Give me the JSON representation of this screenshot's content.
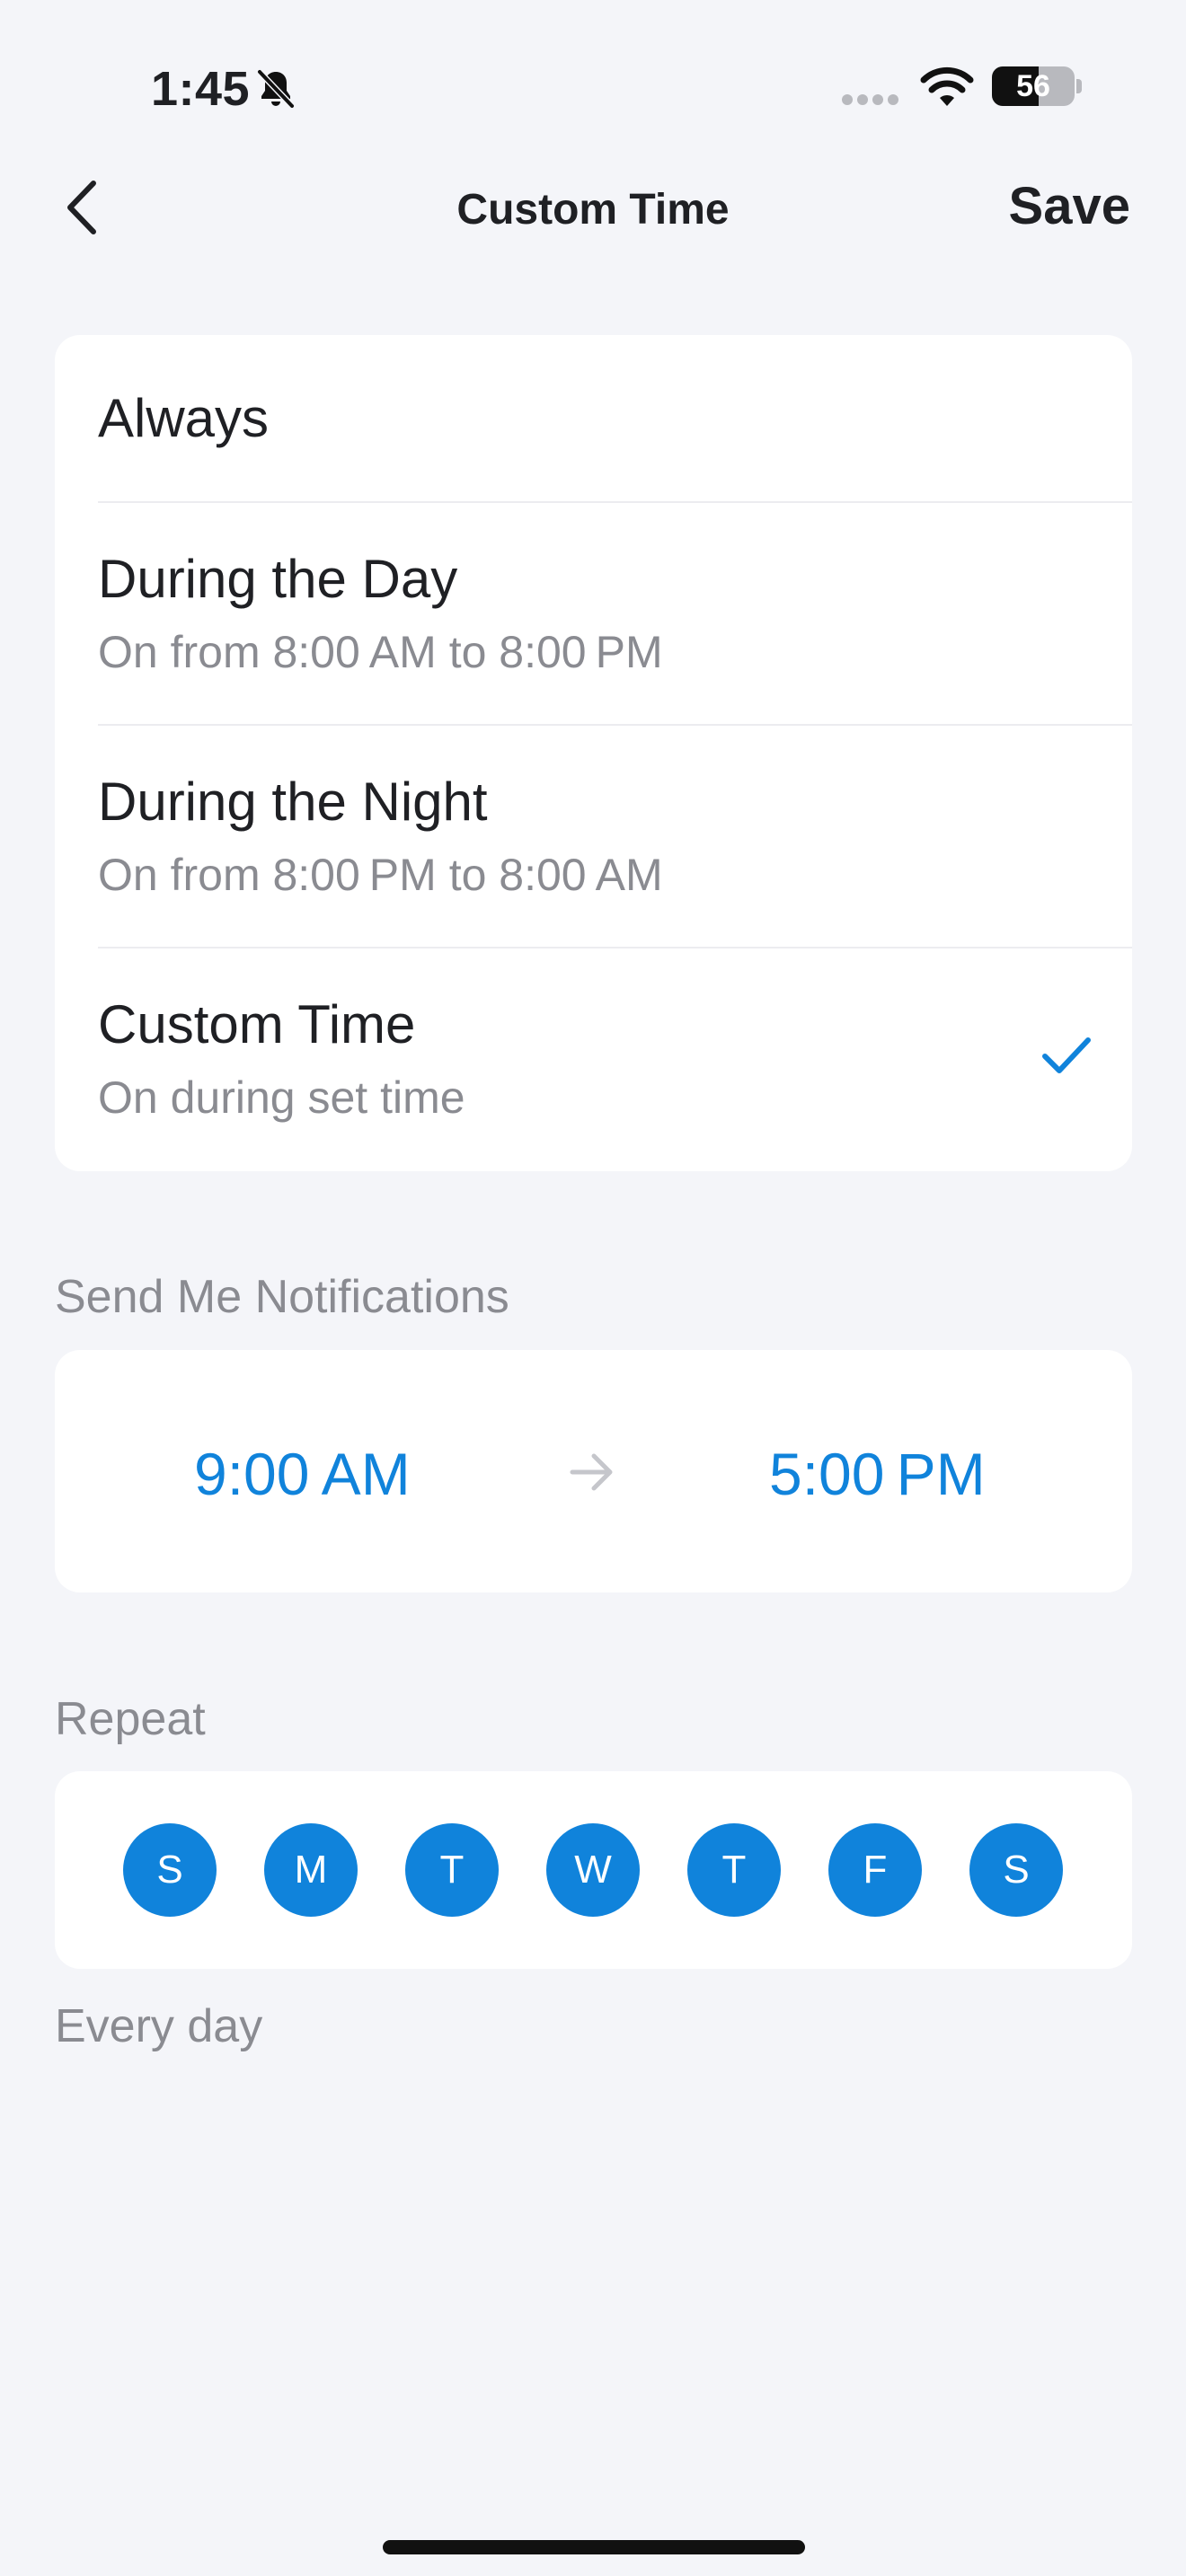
{
  "status_bar": {
    "time": "1:45",
    "battery_level": "56",
    "icons": [
      "bell-slash-icon",
      "signal-dots-icon",
      "wifi-icon",
      "battery-icon"
    ]
  },
  "nav": {
    "title": "Custom Time",
    "save_label": "Save",
    "back_icon": "chevron-left-icon"
  },
  "modes": [
    {
      "title": "Always",
      "subtitle": ""
    },
    {
      "title": "During the Day",
      "subtitle": "On from 8:00 AM to 8:00 PM"
    },
    {
      "title": "During the Night",
      "subtitle": "On from 8:00 PM to 8:00 AM"
    },
    {
      "title": "Custom Time",
      "subtitle": "On during set time",
      "selected": true
    }
  ],
  "notifications": {
    "label": "Send Me Notifications",
    "start_time": "9:00 AM",
    "end_time": "5:00 PM"
  },
  "repeat": {
    "label": "Repeat",
    "days": [
      "S",
      "M",
      "T",
      "W",
      "T",
      "F",
      "S"
    ],
    "summary": "Every day"
  },
  "colors": {
    "accent": "#1083db",
    "background": "#f4f5f9",
    "card": "#ffffff",
    "secondary_text": "#8a8b91"
  }
}
